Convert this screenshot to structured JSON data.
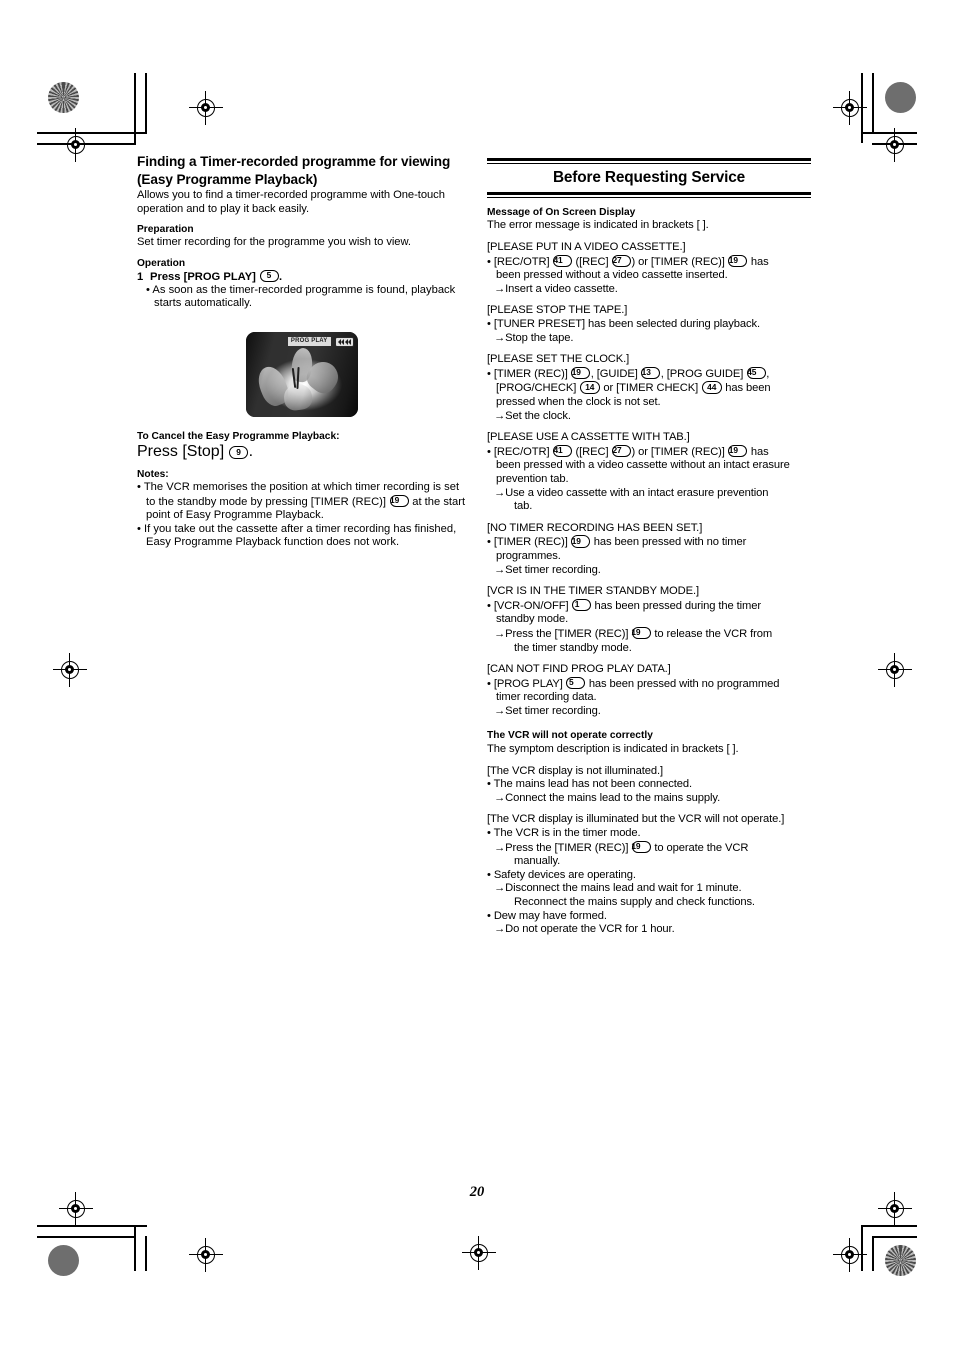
{
  "page": {
    "number": "20"
  },
  "left_column": {
    "title": "Finding a Timer-recorded programme for viewing (Easy Programme Playback)",
    "intro": "Allows you to find a timer-recorded programme with One-touch operation and to play it back easily.",
    "preparation_heading": "Preparation",
    "preparation_text": "Set timer recording for the programme you wish to view.",
    "operation_heading": "Operation",
    "step": {
      "number": "1",
      "text_before": "Press [PROG PLAY]",
      "keyref": "5",
      "text_after": "."
    },
    "step_bullet": "• As soon as the timer-recorded programme is found, playback starts automatically.",
    "figure": {
      "osd_label": "PROG PLAY",
      "osd_arrows": "◀◀◀◀",
      "alt": "TV screen showing a flower with PROG PLAY on-screen display"
    },
    "cancel_heading": "To Cancel the Easy Programme Playback:",
    "cancel_text_before": "Press [Stop]",
    "cancel_keyref": "9",
    "cancel_text_after": ".",
    "notes_heading": "Notes:",
    "notes": [
      {
        "part1": "• The VCR memorises the position at which timer recording is set to the standby mode by pressing [TIMER (REC)]",
        "keyref": "19",
        "part2": "at the start point of Easy Programme Playback."
      },
      {
        "part1": "• If you take out the cassette after a timer recording has finished, Easy Programme Playback function does not work.",
        "keyref": "",
        "part2": ""
      }
    ]
  },
  "right_column": {
    "title": "Before Requesting Service",
    "osd_section": {
      "heading": "Message of On Screen Display",
      "subtitle": "The error message is indicated in brackets [    ].",
      "entries": [
        {
          "message": "[PLEASE PUT IN A VIDEO CASSETTE.]",
          "cause_pre": "• [REC/OTR]",
          "cause_ref1": "41",
          "cause_mid1": "([REC]",
          "cause_ref2": "27",
          "cause_mid2": ") or [TIMER (REC)]",
          "cause_ref3": "19",
          "cause_post": "has",
          "cause_cont": "been pressed without a video cassette inserted.",
          "remedy": "→Insert a video cassette.",
          "remedy_cont": ""
        },
        {
          "message": "[PLEASE STOP THE TAPE.]",
          "cause_pre": "• [TUNER PRESET] has been selected during playback.",
          "cause_ref1": "",
          "cause_mid1": "",
          "cause_ref2": "",
          "cause_mid2": "",
          "cause_ref3": "",
          "cause_post": "",
          "cause_cont": "",
          "remedy": "→Stop the tape.",
          "remedy_cont": ""
        }
      ],
      "clock_entry": {
        "message": "[PLEASE SET THE CLOCK.]",
        "pre": "• [TIMER (REC)]",
        "ref1": "19",
        "mid1": ", [GUIDE]",
        "ref2": "13",
        "mid2": ", [PROG GUIDE]",
        "ref3": "45",
        "mid3": ",",
        "line2_pre": "[PROG/CHECK]",
        "ref4": "14",
        "line2_mid": "or [TIMER CHECK]",
        "ref5": "44",
        "line2_post": "has been",
        "line3": "pressed when the clock is not set.",
        "remedy": "→Set the clock."
      },
      "tab_entry": {
        "message": "[PLEASE USE A CASSETTE WITH TAB.]",
        "pre": "• [REC/OTR]",
        "ref1": "41",
        "mid1": "([REC]",
        "ref2": "27",
        "mid2": ") or [TIMER (REC)]",
        "ref3": "19",
        "post": "has",
        "line2": "been pressed with a video cassette without an intact erasure",
        "line3": "prevention tab.",
        "remedy": "→Use a video cassette with an intact erasure prevention",
        "remedy_cont": "tab."
      },
      "notimer_entry": {
        "message": "[NO TIMER RECORDING HAS BEEN SET.]",
        "pre": "• [TIMER (REC)]",
        "ref1": "19",
        "post": "has been pressed with no timer",
        "line2": "programmes.",
        "remedy": "→Set timer recording."
      },
      "standby_entry": {
        "message": "[VCR IS IN THE TIMER STANDBY MODE.]",
        "pre": "• [VCR-ON/OFF]",
        "ref1": "1",
        "post": "has been pressed during the timer",
        "line2": "standby mode.",
        "remedy_pre": "→Press the [TIMER (REC)]",
        "remedy_ref": "19",
        "remedy_post": "to release the VCR from",
        "remedy_cont": "the timer standby mode."
      },
      "progplay_entry": {
        "message": "[CAN NOT FIND PROG PLAY DATA.]",
        "pre": "• [PROG PLAY]",
        "ref1": "5",
        "post": "has been pressed with no programmed",
        "line2": "timer recording data.",
        "remedy": "→Set timer recording."
      }
    },
    "operate_section": {
      "heading": "The VCR will not operate correctly",
      "subtitle": "The symptom description is indicated in brackets [    ].",
      "entry1": {
        "message": "[The VCR display is not illuminated.]",
        "cause": "• The mains lead has not been connected.",
        "remedy": "→Connect the mains lead to the mains supply."
      },
      "entry2": {
        "message": "[The VCR display is illuminated but the VCR will not operate.]",
        "cause": "• The VCR is in the timer mode.",
        "remedy_pre": "→Press the [TIMER (REC)]",
        "remedy_ref": "19",
        "remedy_post": "to operate the VCR",
        "remedy_cont": "manually.",
        "cause2": "• Safety devices are operating.",
        "remedy2": "→Disconnect the mains lead and wait for 1 minute.",
        "remedy2_cont": "Reconnect the mains supply and check functions.",
        "cause3": "• Dew may have formed.",
        "remedy3": "→Do not operate the VCR for 1 hour."
      }
    }
  }
}
